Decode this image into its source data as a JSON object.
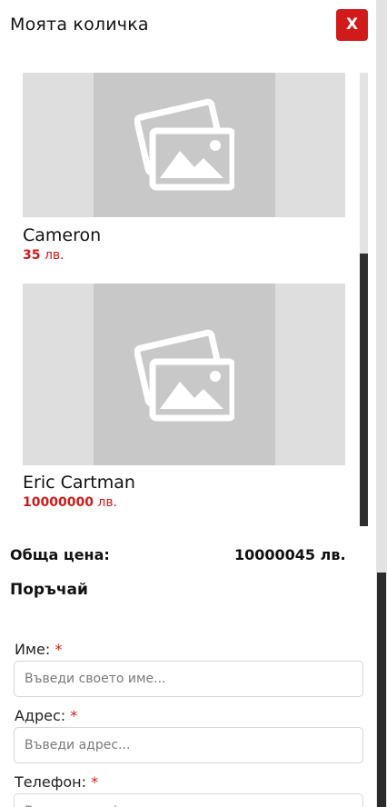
{
  "header": {
    "title": "Моята количка",
    "close_label": "X"
  },
  "items": [
    {
      "name": "Cameron",
      "price": "35",
      "currency": "лв."
    },
    {
      "name": "Eric Cartman",
      "price": "10000000",
      "currency": "лв."
    }
  ],
  "total": {
    "label": "Обща цена:",
    "value": "10000045 лв."
  },
  "order": {
    "heading": "Поръчай",
    "fields": [
      {
        "label": "Име:",
        "required_mark": "*",
        "placeholder": "Въведи своето име..."
      },
      {
        "label": "Адрес:",
        "required_mark": "*",
        "placeholder": "Въведи адрес..."
      },
      {
        "label": "Телефон:",
        "required_mark": "*",
        "placeholder": "Въведи телефон..."
      }
    ]
  },
  "colors": {
    "accent": "#d11a1a",
    "image_placeholder_bg": "#dedede",
    "scroll_thumb": "#2e2e2e"
  },
  "icons": {
    "image_placeholder": "image-placeholder-icon"
  }
}
